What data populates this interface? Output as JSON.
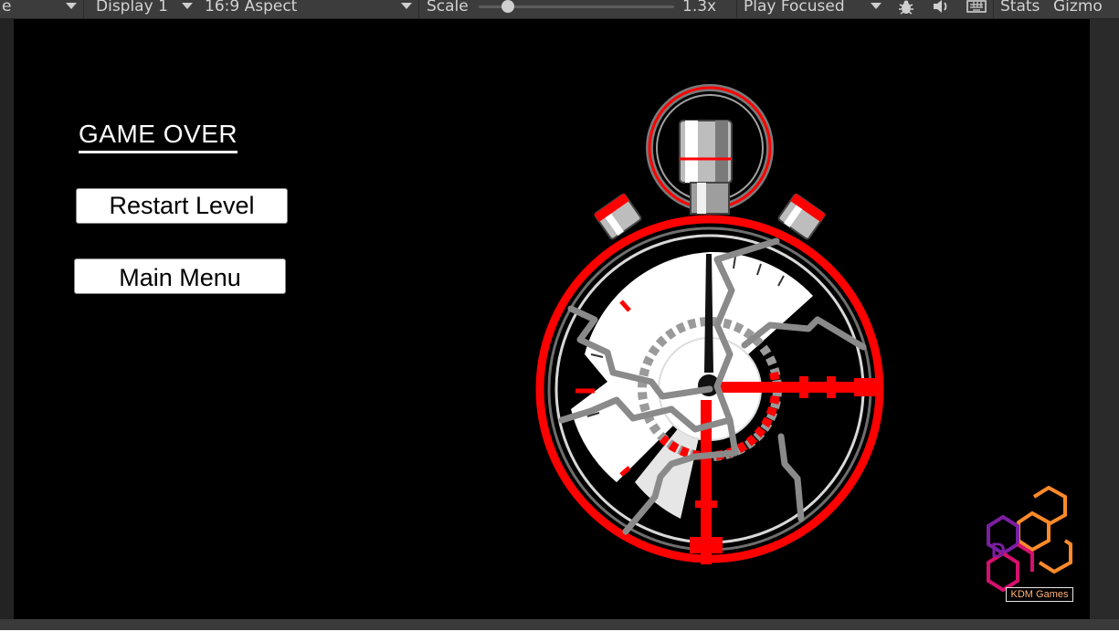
{
  "toolbar": {
    "game_tab_label": "e",
    "display_label": "Display 1",
    "aspect_label": "16:9 Aspect",
    "scale_label": "Scale",
    "scale_value": "1.3x",
    "scale_slider_level": 0.15,
    "play_mode_label": "Play Focused",
    "stats_label": "Stats",
    "gizmos_label": "Gizmo",
    "icons": [
      "bug-icon",
      "speaker-icon",
      "keyboard-icon"
    ]
  },
  "game": {
    "title": "GAME OVER",
    "restart_label": "Restart Level",
    "main_menu_label": "Main Menu"
  },
  "logo": {
    "text": "KDM Games"
  },
  "colors": {
    "toolbar_bg": "#3c3c3c",
    "toolbar_text": "#d2d2d2",
    "screen_bg": "#000000",
    "stopwatch_red": "#ff0000",
    "crack_gray": "#8a8a8a",
    "logo_orange": "#ff8a2a",
    "logo_magenta": "#d6106e",
    "logo_purple": "#7a1fa0"
  }
}
